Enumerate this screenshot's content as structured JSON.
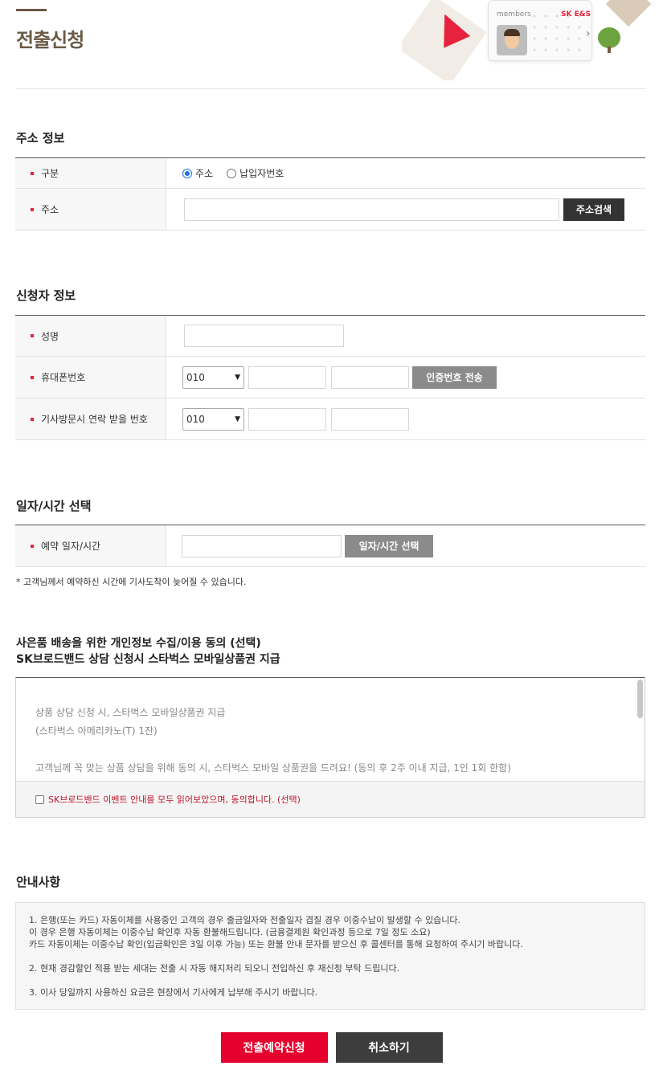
{
  "page": {
    "title": "전출신청"
  },
  "hero": {
    "members_label": "members",
    "brand_label": "SK E&S",
    "chevron": "›"
  },
  "address_section": {
    "title": "주소 정보",
    "type_label": "구분",
    "radio_options": [
      {
        "label": "주소",
        "checked": true
      },
      {
        "label": "납입자번호",
        "checked": false
      }
    ],
    "address_label": "주소",
    "address_value": "",
    "search_button": "주소검색"
  },
  "applicant_section": {
    "title": "신청자 정보",
    "name_label": "성명",
    "name_value": "",
    "phone_label": "휴대폰번호",
    "phone_prefix": "010",
    "verify_button": "인증번호 전송",
    "visit_phone_label": "기사방문시 연락 받을 번호",
    "visit_phone_prefix": "010"
  },
  "schedule_section": {
    "title": "일자/시간 선택",
    "date_label": "예약 일자/시간",
    "date_value": "",
    "select_button": "일자/시간 선택",
    "note": "* 고객님께서 예약하신 시간에 기사도착이 늦어질 수 있습니다."
  },
  "consent_section": {
    "title_line1": "사은품 배송을 위한 개인정보 수집/이용 동의 (선택)",
    "title_line2": "SK브로드밴드 상담 신청시 스타벅스 모바일상품권 지급",
    "lines": [
      "상품 상담 신청 시, 스타벅스 모바일상품권 지급",
      "(스타벅스 아메리카노(T) 1잔)",
      "",
      "고객님께 꼭 맞는 상품 상담을 위해 동의 시, 스타벅스 모바일 상품권을 드려요! (동의 후 2주 이내 지급, 1인 1회 한함)"
    ],
    "checkbox_label": "SK브로드밴드 이벤트 안내를 모두 읽어보았으며, 동의합니다. (선택)",
    "checked": false
  },
  "notice_section": {
    "title": "안내사항",
    "item1_line1": "1. 은행(또는 카드) 자동이체를 사용중인 고객의 경우 출금일자와 전출일자 겹칠 경우 이중수납이 발생할 수 있습니다.",
    "item1_line2": "이 경우 은행 자동이체는 이중수납 확인후 자동 환불해드립니다. (금융결제원 확인과정 등으로 7일 정도 소요)",
    "item1_line3": "카드 자동이체는 이중수납 확인(입금확인은 3일 이후 가능) 또는 환불 안내 문자를 받으신 후 콜센터를 통해 요청하여 주시기 바랍니다.",
    "item2": "2. 현재 경감할인 적용 받는 세대는 전출 시 자동 해지처리 되오니 전입하신 후 재신청 부탁 드립니다.",
    "item3": "3. 이사 당일까지 사용하신 요금은 현장에서 기사에게 납부해 주시기 바랍니다."
  },
  "actions": {
    "submit": "전출예약신청",
    "cancel": "취소하기"
  },
  "colors": {
    "brand_brown": "#6b5a45",
    "accent_red": "#e6002d",
    "dark": "#333333",
    "gray_button": "#8b8b8b"
  }
}
